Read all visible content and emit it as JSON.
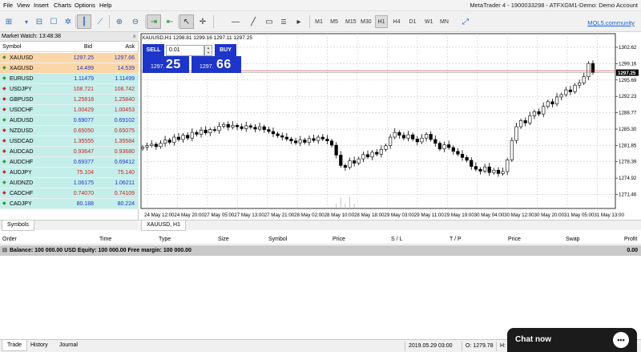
{
  "window": {
    "title": "MetaTrader 4 - 1900033298 - ATFXGM1-Demo: Demo Account"
  },
  "menu": [
    "File",
    "View",
    "Insert",
    "Charts",
    "Options",
    "Help"
  ],
  "toolbar": {
    "timeframes": [
      "M1",
      "M5",
      "M15",
      "M30",
      "H1",
      "H4",
      "D1",
      "W1",
      "MN"
    ],
    "active_timeframe": "H1",
    "mql5_link": "MQL5.community"
  },
  "market_watch": {
    "title": "Market Watch: 13:48:38",
    "close": "×",
    "headers": {
      "symbol": "Symbol",
      "bid": "Bid",
      "ask": "Ask"
    },
    "rows": [
      {
        "symbol": "XAUUSD",
        "bid": "1297.25",
        "ask": "1297.66",
        "dir": "up",
        "bg": "#fbd6a8"
      },
      {
        "symbol": "XAGUSD",
        "bid": "14.499",
        "ask": "14.539",
        "dir": "up",
        "bg": "#fbd6a8"
      },
      {
        "symbol": "EURUSD",
        "bid": "1.11479",
        "ask": "1.11499",
        "dir": "up",
        "bg": "#c4eeea"
      },
      {
        "symbol": "USDJPY",
        "bid": "108.721",
        "ask": "108.742",
        "dir": "down",
        "bg": "#c4eeea"
      },
      {
        "symbol": "GBPUSD",
        "bid": "1.25818",
        "ask": "1.25840",
        "dir": "down",
        "bg": "#c4eeea"
      },
      {
        "symbol": "USDCHF",
        "bid": "1.00429",
        "ask": "1.00453",
        "dir": "down",
        "bg": "#c4eeea"
      },
      {
        "symbol": "AUDUSD",
        "bid": "0.69077",
        "ask": "0.69102",
        "dir": "up",
        "bg": "#c4eeea"
      },
      {
        "symbol": "NZDUSD",
        "bid": "0.65050",
        "ask": "0.65075",
        "dir": "down",
        "bg": "#c4eeea"
      },
      {
        "symbol": "USDCAD",
        "bid": "1.35555",
        "ask": "1.35584",
        "dir": "down",
        "bg": "#c4eeea"
      },
      {
        "symbol": "AUDCAD",
        "bid": "0.93647",
        "ask": "0.93680",
        "dir": "down",
        "bg": "#c4eeea"
      },
      {
        "symbol": "AUDCHF",
        "bid": "0.69377",
        "ask": "0.69412",
        "dir": "up",
        "bg": "#c4eeea"
      },
      {
        "symbol": "AUDJPY",
        "bid": "75.104",
        "ask": "75.140",
        "dir": "down",
        "bg": "#c4eeea"
      },
      {
        "symbol": "AUDNZD",
        "bid": "1.06175",
        "ask": "1.06211",
        "dir": "up",
        "bg": "#c4eeea"
      },
      {
        "symbol": "CADCHF",
        "bid": "0.74070",
        "ask": "0.74109",
        "dir": "down",
        "bg": "#c4eeea"
      },
      {
        "symbol": "CADJPY",
        "bid": "80.188",
        "ask": "80.224",
        "dir": "up",
        "bg": "#c4eeea"
      }
    ],
    "tab": "Symbols"
  },
  "chart": {
    "ohlc_label": "XAUUSD,H1  1298.81 1299.16 1297.11 1297.25",
    "sell_label": "SELL",
    "buy_label": "BUY",
    "lot": "0.01",
    "sell_small": "1297.",
    "sell_big": "25",
    "buy_small": "1297.",
    "buy_big": "66",
    "tab": "XAUUSD, H1"
  },
  "chart_data": {
    "type": "candlestick",
    "symbol": "XAUUSD",
    "timeframe": "H1",
    "ylim": [
      1268.5,
      1305.5
    ],
    "y_ticks": [
      "1302.62",
      "1299.16",
      "1295.69",
      "1292.23",
      "1288.77",
      "1285.30",
      "1281.85",
      "1278.39",
      "1274.92",
      "1271.46"
    ],
    "current_price": "1297.25",
    "bid_line": 1297.25,
    "ask_line": 1297.66,
    "x_ticks": [
      "24 May 12:00",
      "24 May 20:00",
      "27 May 05:00",
      "27 May 13:00",
      "27 May 21:00",
      "28 May 02:00",
      "28 May 10:00",
      "28 May 18:00",
      "29 May 03:00",
      "29 May 11:00",
      "29 May 19:00",
      "30 May 04:00",
      "30 May 12:00",
      "30 May 20:00",
      "31 May 05:00",
      "31 May 13:00"
    ],
    "closes": [
      1281.5,
      1281.8,
      1282.1,
      1281.6,
      1282.3,
      1283.0,
      1282.5,
      1283.6,
      1283.1,
      1284.0,
      1283.4,
      1284.6,
      1284.2,
      1285.1,
      1284.5,
      1285.2,
      1285.0,
      1285.9,
      1286.3,
      1285.7,
      1286.1,
      1285.8,
      1285.4,
      1286.0,
      1285.7,
      1285.3,
      1285.8,
      1285.2,
      1284.8,
      1284.3,
      1283.9,
      1283.6,
      1283.2,
      1282.8,
      1282.4,
      1283.0,
      1282.5,
      1283.3,
      1282.9,
      1283.6,
      1283.2,
      1282.8,
      1281.9,
      1279.8,
      1277.6,
      1277.2,
      1278.6,
      1278.1,
      1279.0,
      1279.9,
      1279.4,
      1280.4,
      1280.0,
      1281.0,
      1281.8,
      1283.6,
      1284.6,
      1284.0,
      1283.4,
      1284.1,
      1283.2,
      1282.6,
      1283.4,
      1284.2,
      1283.1,
      1282.3,
      1281.1,
      1282.0,
      1281.4,
      1280.6,
      1280.0,
      1279.3,
      1278.7,
      1277.4,
      1276.8,
      1276.4,
      1277.3,
      1276.1,
      1276.6,
      1275.9,
      1276.3,
      1278.8,
      1282.9,
      1285.8,
      1287.1,
      1286.6,
      1288.1,
      1289.0,
      1288.5,
      1290.1,
      1291.1,
      1290.6,
      1292.1,
      1292.6,
      1293.6,
      1293.2,
      1294.6,
      1295.1,
      1296.4,
      1299.2,
      1297.25
    ]
  },
  "terminal": {
    "headers": [
      "Order",
      "Time",
      "Type",
      "Size",
      "Symbol",
      "Price",
      "S / L",
      "T / P",
      "Price",
      "Swap",
      "Profit"
    ],
    "balance_text": "Balance: 100 000.00 USD  Equity: 100 000.00  Free margin: 100 000.00",
    "balance_profit": "0.00",
    "tabs": [
      "Trade",
      "History",
      "Journal"
    ],
    "active_tab": "Trade"
  },
  "status": {
    "datetime": "2019.05.29 03:00",
    "open": "O: 1279.78",
    "high": "H:"
  },
  "chat": {
    "label": "Chat now"
  }
}
